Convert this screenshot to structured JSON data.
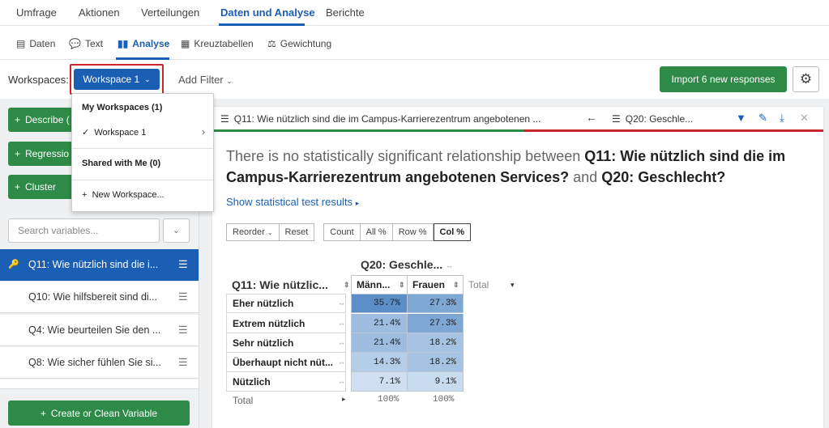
{
  "topnav": {
    "tabs": [
      "Umfrage",
      "Aktionen",
      "Verteilungen",
      "Daten und Analyse",
      "Berichte"
    ],
    "active": "Daten und Analyse"
  },
  "subnav": {
    "tabs": [
      "Daten",
      "Text",
      "Analyse",
      "Kreuztabellen",
      "Gewichtung"
    ],
    "active": "Analyse"
  },
  "workspace_bar": {
    "label": "Workspaces:",
    "current": "Workspace 1",
    "add_filter": "Add Filter",
    "import_button": "Import 6 new responses"
  },
  "menu": {
    "my_workspaces": "My Workspaces (1)",
    "workspace_item": "Workspace 1",
    "shared": "Shared with Me (0)",
    "new_workspace": "New Workspace..."
  },
  "left": {
    "buttons": [
      "Describe (",
      "Regressio",
      "Cluster"
    ],
    "search_placeholder": "Search variables...",
    "variables": [
      "Q11: Wie nützlich sind die i...",
      "Q10: Wie hilfsbereit sind di...",
      "Q4: Wie beurteilen Sie den ...",
      "Q8: Wie sicher fühlen Sie si..."
    ],
    "create_button": "Create or Clean Variable"
  },
  "card": {
    "q_left": "Q11: Wie nützlich sind die im Campus-Karrierezentrum angebotenen ...",
    "q_right": "Q20: Geschle...",
    "headline_pre": "There is no statistically significant relationship between ",
    "headline_q1": "Q11: Wie nützlich sind die im Campus-Karrierezentrum angebotenen Services?",
    "headline_and": " and ",
    "headline_q2": "Q20: Geschlecht?",
    "show_stats": "Show statistical test results",
    "toolbar": [
      "Reorder",
      "Reset",
      "Count",
      "All %",
      "Row %",
      "Col %"
    ],
    "active_toolbar": "Col %"
  },
  "table": {
    "col_header": "Q20: Geschle...",
    "row_header": "Q11: Wie nützlic...",
    "columns": [
      "Männ...",
      "Frauen",
      "Total"
    ],
    "rows": [
      {
        "label": "Eher nützlich",
        "values": [
          "35.7%",
          "27.3%"
        ]
      },
      {
        "label": "Extrem nützlich",
        "values": [
          "21.4%",
          "27.3%"
        ]
      },
      {
        "label": "Sehr nützlich",
        "values": [
          "21.4%",
          "18.2%"
        ]
      },
      {
        "label": "Überhaupt nicht nüt...",
        "values": [
          "14.3%",
          "18.2%"
        ]
      },
      {
        "label": "Nützlich",
        "values": [
          "7.1%",
          "9.1%"
        ]
      }
    ],
    "total_label": "Total",
    "totals": [
      "100%",
      "100%"
    ]
  },
  "colors": {
    "blue": "#1a5fb4",
    "green": "#2e8b47",
    "red": "#c8282d"
  }
}
